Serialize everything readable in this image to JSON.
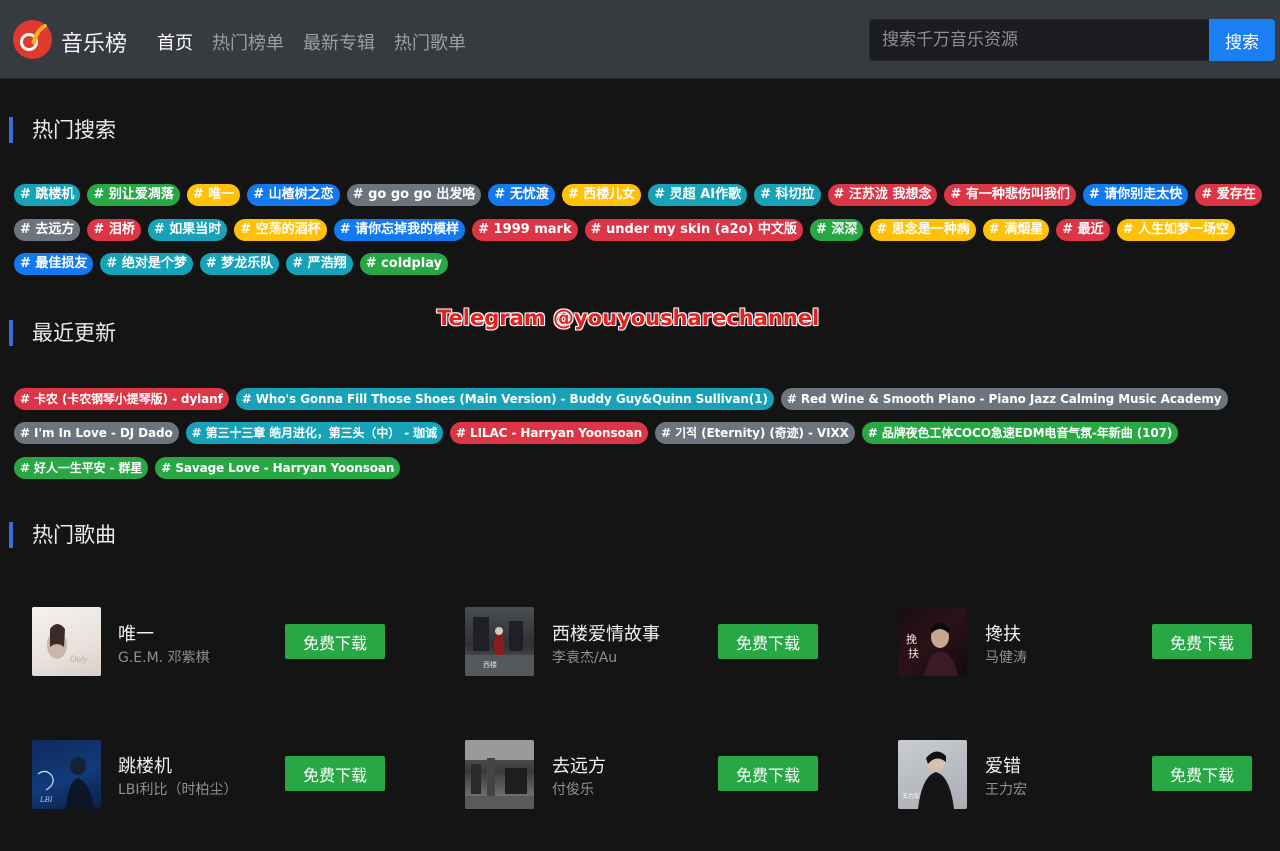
{
  "header": {
    "logo_text": "音乐榜",
    "nav": [
      "首页",
      "热门榜单",
      "最新专辑",
      "热门歌单"
    ],
    "search_placeholder": "搜索千万音乐资源",
    "search_button": "搜索",
    "colors": {
      "header_bg": "#373a3f",
      "accent": "#1a7ff2",
      "logo": "#e03a2f"
    }
  },
  "hot_search": {
    "title": "热门搜索",
    "rows": [
      [
        {
          "label": "# 跳楼机",
          "color": "teal"
        },
        {
          "label": "# 别让爱凋落",
          "color": "green"
        },
        {
          "label": "# 唯一",
          "color": "yellow"
        },
        {
          "label": "# 山楂树之恋",
          "color": "blue"
        },
        {
          "label": "# go go go 出发咯",
          "color": "gray"
        },
        {
          "label": "# 无忧渡",
          "color": "blue"
        },
        {
          "label": "# 西楼儿女",
          "color": "yellow"
        },
        {
          "label": "# 灵超 AI作歌",
          "color": "teal"
        },
        {
          "label": "# 科切拉",
          "color": "teal"
        },
        {
          "label": "# 汪苏泷 我想念",
          "color": "red"
        },
        {
          "label": "# 有一种悲伤叫我们",
          "color": "red"
        },
        {
          "label": "# 请你别走太快",
          "color": "blue"
        },
        {
          "label": "# 爱存在",
          "color": "red"
        }
      ],
      [
        {
          "label": "# 去远方",
          "color": "gray"
        },
        {
          "label": "# 泪桥",
          "color": "red"
        },
        {
          "label": "# 如果当时",
          "color": "teal"
        },
        {
          "label": "# 空荡的酒杯",
          "color": "yellow"
        },
        {
          "label": "# 请你忘掉我的模样",
          "color": "blue"
        },
        {
          "label": "# 1999 mark",
          "color": "red"
        },
        {
          "label": "# under my skin (a2o) 中文版",
          "color": "red"
        },
        {
          "label": "# 深深",
          "color": "green"
        },
        {
          "label": "# 思念是一种病",
          "color": "yellow"
        },
        {
          "label": "# 满烟星",
          "color": "yellow"
        },
        {
          "label": "# 最近",
          "color": "red"
        },
        {
          "label": "# 人生如梦一场空",
          "color": "yellow"
        }
      ],
      [
        {
          "label": "# 最佳损友",
          "color": "blue"
        },
        {
          "label": "# 绝对是个梦",
          "color": "teal"
        },
        {
          "label": "# 梦龙乐队",
          "color": "teal"
        },
        {
          "label": "# 严浩翔",
          "color": "teal"
        },
        {
          "label": "# coldplay",
          "color": "green"
        }
      ]
    ]
  },
  "watermark": "Telegram @youyousharechannel",
  "recent": {
    "title": "最近更新",
    "rows": [
      [
        {
          "label": "# 卡农 (卡农钢琴小提琴版) - dylanf",
          "color": "red"
        },
        {
          "label": "# Who's Gonna Fill Those Shoes (Main Version) - Buddy Guy&Quinn Sullivan(1)",
          "color": "teal"
        },
        {
          "label": "# Red Wine & Smooth Piano - Piano Jazz Calming Music Academy",
          "color": "gray"
        }
      ],
      [
        {
          "label": "# I'm In Love - DJ Dado",
          "color": "gray"
        },
        {
          "label": "# 第三十三章 皓月进化，第三头（中） - 珈诚",
          "color": "teal"
        },
        {
          "label": "# LILAC - Harryan Yoonsoan",
          "color": "red"
        },
        {
          "label": "# 기적 (Eternity) (奇迹) - VIXX",
          "color": "gray"
        },
        {
          "label": "# 品牌夜色工体COCO急速EDM电音气氛-年新曲 (107)",
          "color": "green"
        }
      ],
      [
        {
          "label": "# 好人一生平安 - 群星",
          "color": "green"
        },
        {
          "label": "# Savage Love - Harryan Yoonsoan",
          "color": "green"
        }
      ]
    ]
  },
  "hot_songs": {
    "title": "热门歌曲",
    "download_label": "免费下载",
    "songs": [
      {
        "title": "唯一",
        "artist": "G.E.M. 邓紫棋",
        "cover": "light"
      },
      {
        "title": "西楼爱情故事",
        "artist": "李袁杰/Au",
        "cover": "gray"
      },
      {
        "title": "搀扶",
        "artist": "马健涛",
        "cover": "dark-red"
      },
      {
        "title": "跳楼机",
        "artist": "LBI利比（时柏尘）",
        "cover": "blue"
      },
      {
        "title": "去远方",
        "artist": "付俊乐",
        "cover": "bw"
      },
      {
        "title": "爱错",
        "artist": "王力宏",
        "cover": "dark"
      }
    ]
  }
}
